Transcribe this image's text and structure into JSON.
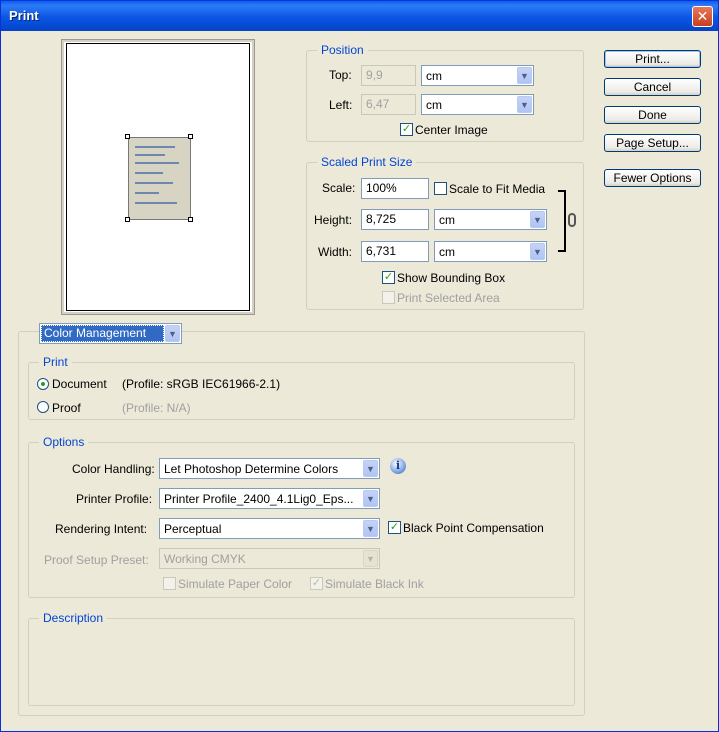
{
  "window": {
    "title": "Print",
    "close_glyph": "✕"
  },
  "position": {
    "legend": "Position",
    "top_label": "Top:",
    "top_value": "9,9",
    "top_unit": "cm",
    "left_label": "Left:",
    "left_value": "6,47",
    "left_unit": "cm",
    "center_image_label": "Center Image",
    "center_image_checked": true
  },
  "scaled": {
    "legend": "Scaled Print Size",
    "scale_label": "Scale:",
    "scale_value": "100%",
    "scale_to_fit_label": "Scale to Fit Media",
    "scale_to_fit_checked": false,
    "height_label": "Height:",
    "height_value": "8,725",
    "height_unit": "cm",
    "width_label": "Width:",
    "width_value": "6,731",
    "width_unit": "cm",
    "bounding_box_label": "Show Bounding Box",
    "bounding_box_checked": true,
    "print_selected_label": "Print Selected Area",
    "print_selected_checked": false
  },
  "buttons": {
    "print": "Print...",
    "cancel": "Cancel",
    "done": "Done",
    "page_setup": "Page Setup...",
    "fewer_options": "Fewer Options"
  },
  "color_management": {
    "section_select": "Color Management",
    "print_group": {
      "legend": "Print",
      "document_label": "Document",
      "document_profile": "(Profile: sRGB IEC61966-2.1)",
      "proof_label": "Proof",
      "proof_profile": "(Profile: N/A)"
    },
    "options_group": {
      "legend": "Options",
      "color_handling_label": "Color Handling:",
      "color_handling_value": "Let Photoshop Determine Colors",
      "printer_profile_label": "Printer Profile:",
      "printer_profile_value": "Printer Profile_2400_4.1Lig0_Eps...",
      "rendering_intent_label": "Rendering Intent:",
      "rendering_intent_value": "Perceptual",
      "black_point_label": "Black Point Compensation",
      "black_point_checked": true,
      "proof_setup_label": "Proof Setup Preset:",
      "proof_setup_value": "Working CMYK",
      "simulate_paper_label": "Simulate Paper Color",
      "simulate_ink_label": "Simulate Black Ink"
    },
    "description_group": {
      "legend": "Description"
    }
  },
  "icons": {
    "dropdown": "▼",
    "check": "✓",
    "info": "i"
  },
  "colors": {
    "titlebar": "#0a56e4",
    "legend": "#0046d5",
    "selection": "#316ac5",
    "close": "#c6401f"
  }
}
